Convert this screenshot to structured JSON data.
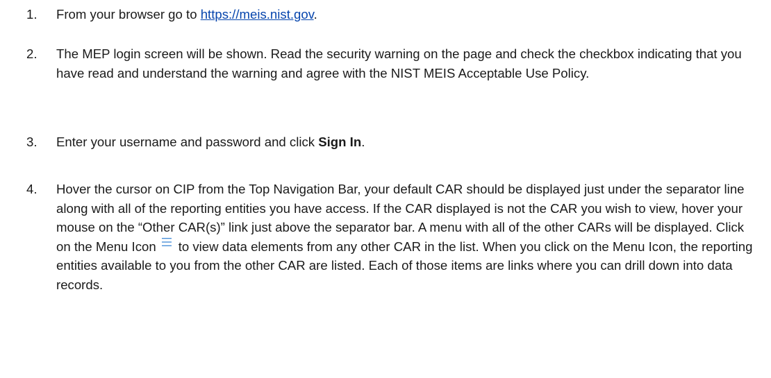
{
  "steps": [
    {
      "number": "1.",
      "text_before": "From your browser go to ",
      "link": "https://meis.nist.gov",
      "text_after": "."
    },
    {
      "number": "2.",
      "text": "The MEP login screen will be shown. Read the security warning on the page and check the checkbox indicating that you have read and understand the warning and agree with the NIST MEIS Acceptable Use Policy."
    },
    {
      "number": "3.",
      "text_before": "Enter your username and password and click ",
      "bold": "Sign In",
      "text_after": "."
    },
    {
      "number": "4.",
      "text_part1": "Hover the cursor on CIP from the Top Navigation Bar, your default CAR should be displayed just under the separator line along with all of the reporting entities you have access. If the CAR displayed is not the CAR you wish to view, hover your mouse on the “Other CAR(s)” link just above the separator bar.  A menu with all of the other CARs will be displayed.  Click on the Menu Icon",
      "text_part2": "to view data elements from any other CAR in the list.  When you click on the Menu Icon, the reporting entities available to you from the other CAR are listed.  Each of those items are links where you can drill down into data records."
    }
  ],
  "icons": {
    "menu": "menu-icon"
  },
  "colors": {
    "link": "#0645ad",
    "menu_icon": "#4a90d9",
    "text": "#1a1a1a"
  }
}
